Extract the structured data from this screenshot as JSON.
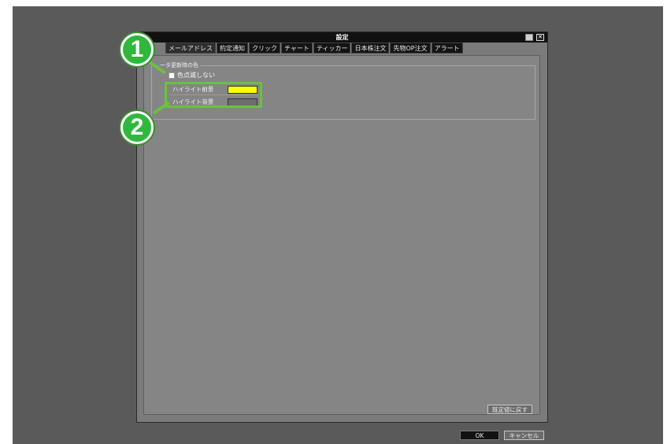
{
  "window": {
    "title": "設定",
    "minimize_icon": "minimize-icon",
    "close_icon": "close-icon"
  },
  "tabs": [
    {
      "label": "メールアドレス",
      "active": true
    },
    {
      "label": "約定通知"
    },
    {
      "label": "クリック"
    },
    {
      "label": "チャート"
    },
    {
      "label": "ティッカー"
    },
    {
      "label": "日本株注文"
    },
    {
      "label": "先物OP注文"
    },
    {
      "label": "アラート"
    }
  ],
  "group": {
    "legend": "ータ更新時の色",
    "checkbox_label": "色点滅しない",
    "checked": false,
    "highlight_fg": {
      "label": "ハイライト前景",
      "color": "#ffff00"
    },
    "highlight_bg": {
      "label": "ハイライト背景",
      "color": "#6e6e6e"
    }
  },
  "buttons": {
    "reset": "既定値に戻す",
    "ok": "OK",
    "cancel": "キャンセル"
  },
  "callouts": {
    "one": "1",
    "two": "2"
  },
  "colors": {
    "callout_green": "#2fb83c",
    "highlight_green": "#6ac141"
  }
}
